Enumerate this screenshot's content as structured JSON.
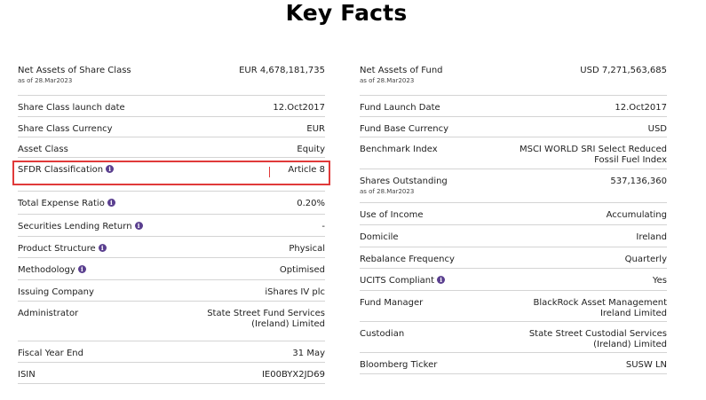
{
  "title": "Key Facts",
  "left": [
    {
      "label": "Net Assets of Share Class",
      "sub": "as of 28.Mar2023",
      "value": "EUR 4,678,181,735",
      "info": false
    },
    {
      "label": "Share Class launch date",
      "value": "12.Oct2017",
      "info": false
    },
    {
      "label": "Share Class Currency",
      "value": "EUR",
      "info": false
    },
    {
      "label": "Asset Class",
      "value": "Equity",
      "info": false
    },
    {
      "label": "SFDR Classification",
      "value": "Article 8",
      "info": true
    },
    {
      "label": "Total Expense Ratio",
      "value": "0.20%",
      "info": true
    },
    {
      "label": "Securities Lending Return",
      "value": "-",
      "info": true
    },
    {
      "label": "Product Structure",
      "value": "Physical",
      "info": true
    },
    {
      "label": "Methodology",
      "value": "Optimised",
      "info": true
    },
    {
      "label": "Issuing Company",
      "value": "iShares IV plc",
      "info": false
    },
    {
      "label": "Administrator",
      "value": "State Street Fund Services",
      "value2": "(Ireland) Limited",
      "info": false
    },
    {
      "label": "Fiscal Year End",
      "value": "31 May",
      "info": false
    },
    {
      "label": "ISIN",
      "value": "IE00BYX2JD69",
      "info": false
    }
  ],
  "right": [
    {
      "label": "Net Assets of Fund",
      "sub": "as of 28.Mar2023",
      "value": "USD 7,271,563,685",
      "info": false
    },
    {
      "label": "Fund Launch Date",
      "value": "12.Oct2017",
      "info": false
    },
    {
      "label": "Fund Base Currency",
      "value": "USD",
      "info": false
    },
    {
      "label": "Benchmark Index",
      "value": "MSCI WORLD SRI Select Reduced",
      "value2": "Fossil Fuel Index",
      "info": false
    },
    {
      "label": "Shares Outstanding",
      "sub": "as of 28.Mar2023",
      "value": "537,136,360",
      "info": false
    },
    {
      "label": "Use of Income",
      "value": "Accumulating",
      "info": false
    },
    {
      "label": "Domicile",
      "value": "Ireland",
      "info": false
    },
    {
      "label": "Rebalance Frequency",
      "value": "Quarterly",
      "info": false
    },
    {
      "label": "UCITS Compliant",
      "value": "Yes",
      "info": true
    },
    {
      "label": "Fund Manager",
      "value": "BlackRock Asset Management",
      "value2": "Ireland Limited",
      "info": false
    },
    {
      "label": "Custodian",
      "value": "State Street Custodial Services",
      "value2": "(Ireland) Limited",
      "info": false
    },
    {
      "label": "Bloomberg Ticker",
      "value": "SUSW LN",
      "info": false
    }
  ],
  "info_glyph": "i",
  "highlight_color": "#e03a3a",
  "info_icon_color": "#5a3f8f"
}
